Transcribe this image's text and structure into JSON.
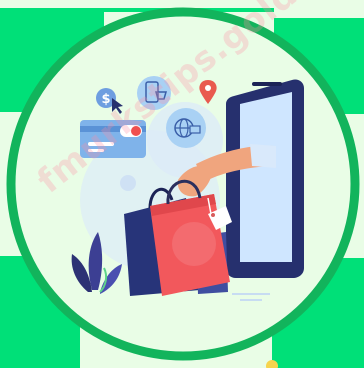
{
  "illustration": {
    "subject": "online shopping",
    "colors": {
      "background": "#e9fde6",
      "checker_green": "#00e078",
      "ring_green": "#12b45c",
      "phone_body": "#26306e",
      "phone_screen": "#cfe6ff",
      "bag_red": "#f2585c",
      "bag_navy": "#273479",
      "card_blue": "#7fb3ea",
      "icon_blue": "#a9d1f4",
      "pin_red": "#e95a4f",
      "hand_skin": "#f0a57e",
      "sleeve": "#d9e9fb"
    },
    "icons": [
      "dollar-cursor-icon",
      "mobile-cart-icon",
      "location-pin-icon",
      "credit-card-icon",
      "globe-icon"
    ]
  },
  "watermark": {
    "text": "fmurkstips.gold"
  }
}
